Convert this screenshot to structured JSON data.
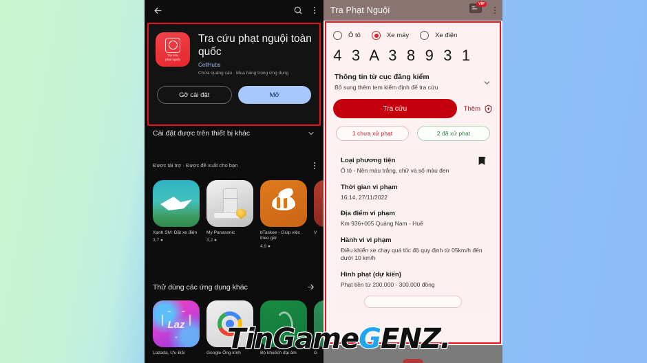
{
  "background": {
    "left_color": "#c9f5cd",
    "right_color": "#8cbcf8"
  },
  "watermark": {
    "part1": "TinGame",
    "part2": "G",
    "part3": "ENZ."
  },
  "play_store": {
    "topbar": {
      "back_icon": "back-arrow-icon",
      "search_icon": "search-icon",
      "overflow_icon": "more-vertical-icon"
    },
    "app": {
      "icon_caption_line1": "Tra cứu",
      "icon_caption_line2": "phạt nguội",
      "title": "Tra cứu phạt nguội toàn quốc",
      "developer": "CellHubs",
      "meta": "Chứa quảng cáo · Mua hàng trong ứng dụng",
      "uninstall_label": "Gỡ cài đặt",
      "open_label": "Mở"
    },
    "other_devices": {
      "label": "Cài đặt được trên thiết bị khác",
      "chevron_icon": "chevron-down-icon"
    },
    "sponsored": {
      "label": "Được tài trợ · Được đề xuất cho bạn",
      "overflow_icon": "more-vertical-icon",
      "apps": [
        {
          "name": "Xanh SM: Đặt xe điện",
          "rating": "3,7 ●"
        },
        {
          "name": "My Panasonic",
          "rating": "3,2 ●"
        },
        {
          "name": "bTaskee - Giúp việc theo giờ",
          "rating": "4,9 ●"
        },
        {
          "name": "V",
          "rating": ""
        }
      ]
    },
    "other_apps": {
      "label": "Thử dùng các ứng dụng khác",
      "arrow_icon": "arrow-right-icon",
      "apps": [
        {
          "name": "Lazada, Ưu Đãi",
          "art_label": "Laz"
        },
        {
          "name": "Google Ống kính",
          "art_label": ""
        },
        {
          "name": "Bộ khuếch đại âm",
          "art_label": ""
        },
        {
          "name": "G",
          "art_label": ""
        }
      ]
    }
  },
  "app_screen": {
    "title": "Tra Phạt Nguội",
    "vip_badge": "VIP",
    "card_icon": "id-card-icon",
    "overflow_icon": "more-vertical-icon",
    "vehicle_types": [
      {
        "label": "Ô tô",
        "selected": false
      },
      {
        "label": "Xe máy",
        "selected": true
      },
      {
        "label": "Xe điện",
        "selected": false
      }
    ],
    "plate": [
      "4",
      "3",
      "A",
      "3",
      "8",
      "9",
      "3",
      "1",
      ""
    ],
    "registry_section": {
      "title": "Thông tin từ cục đăng kiểm",
      "subtitle": "Bổ sung thêm tem kiểm định để tra cứu",
      "chevron_icon": "chevron-down-icon"
    },
    "search_button": "Tra cứu",
    "add_label": "Thêm",
    "add_icon": "shield-plus-icon",
    "chips": [
      {
        "label": "1 chưa xử phạt",
        "style": "unresolved"
      },
      {
        "label": "2 đã xử phạt",
        "style": "resolved"
      }
    ],
    "result": {
      "bookmark_icon": "bookmark-icon",
      "fields": [
        {
          "label": "Loại phương tiện",
          "value": "Ô tô - Nền màu trắng, chữ và số màu đen"
        },
        {
          "label": "Thời gian vi phạm",
          "value": "16:14, 27/11/2022"
        },
        {
          "label": "Địa điểm vi phạm",
          "value": "Km 936+005 Quảng Nam - Huế"
        },
        {
          "label": "Hành vi vi phạm",
          "value": "Điều khiển xe chạy quá tốc độ quy định từ 05km/h đến dưới 10 km/h"
        },
        {
          "label": "Hình phạt (dự kiến)",
          "value": "Phạt tiền từ 200.000 - 300.000 đồng"
        }
      ]
    }
  }
}
